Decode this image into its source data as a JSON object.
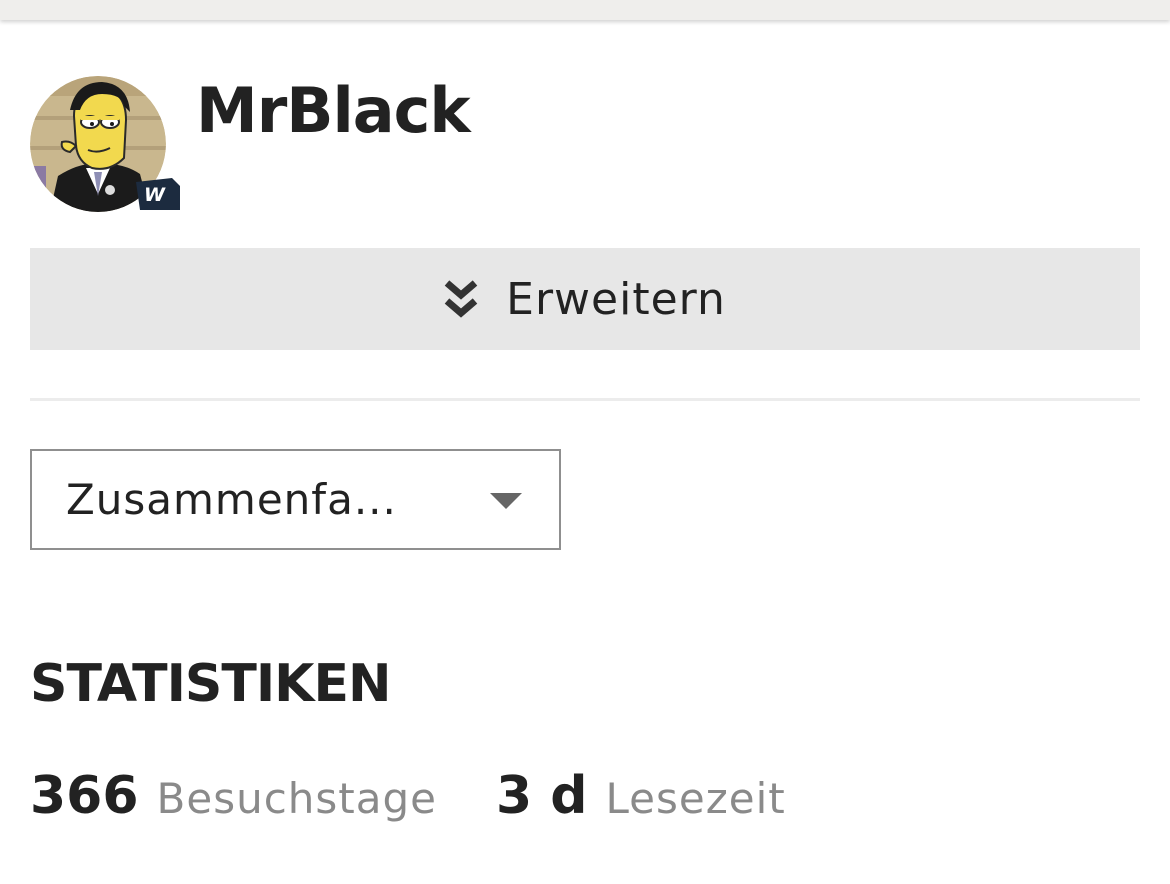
{
  "profile": {
    "username": "MrBlack",
    "badge_letter": "W",
    "badge_color": "#1c2b3f"
  },
  "expand_button": {
    "label": "Erweitern",
    "icon": "double-chevron-down-icon"
  },
  "view_select": {
    "selected_value": "Zusammenfa...",
    "icon": "caret-down-icon"
  },
  "statistics": {
    "title": "STATISTIKEN",
    "items": [
      {
        "value": "366",
        "label": "Besuchstage"
      },
      {
        "value": "3 d",
        "label": "Lesezeit"
      }
    ]
  },
  "colors": {
    "button_bg": "#e7e7e7",
    "text": "#222222",
    "muted_text": "#8a8a8a"
  }
}
